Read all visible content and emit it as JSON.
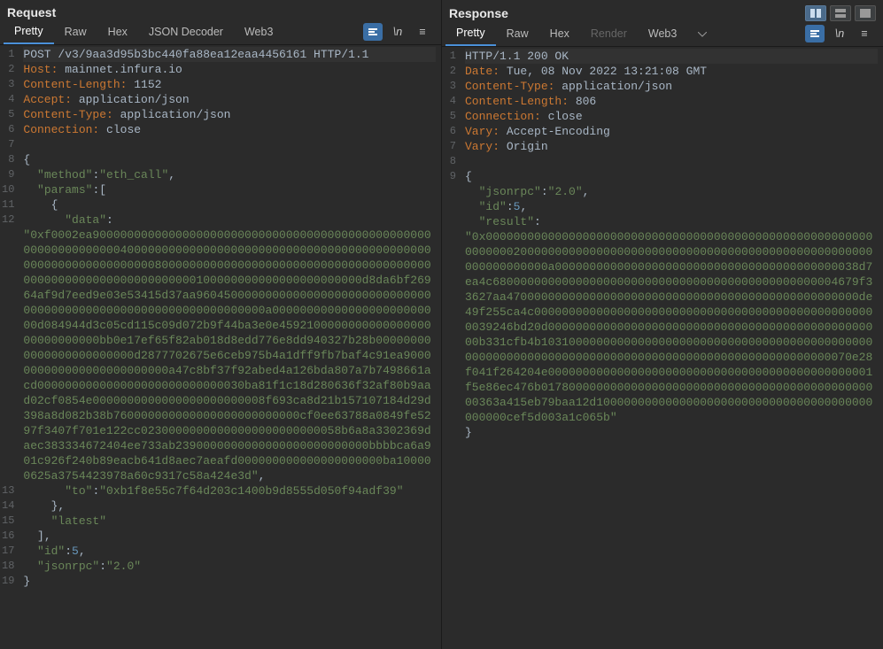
{
  "request": {
    "title": "Request",
    "tabs": [
      "Pretty",
      "Raw",
      "Hex",
      "JSON Decoder",
      "Web3"
    ],
    "activeTab": 0,
    "lines": [
      {
        "n": 1,
        "sel": true,
        "seg": [
          {
            "t": "POST /v3/9aa3d95b3bc440fa88ea12eaa4456161 HTTP/1.1",
            "c": ""
          }
        ]
      },
      {
        "n": 2,
        "seg": [
          {
            "t": "Host:",
            "c": "k-hdr"
          },
          {
            "t": " mainnet.infura.io",
            "c": ""
          }
        ]
      },
      {
        "n": 3,
        "seg": [
          {
            "t": "Content-Length:",
            "c": "k-hdr"
          },
          {
            "t": " 1152",
            "c": ""
          }
        ]
      },
      {
        "n": 4,
        "seg": [
          {
            "t": "Accept:",
            "c": "k-hdr"
          },
          {
            "t": " application/json",
            "c": ""
          }
        ]
      },
      {
        "n": 5,
        "seg": [
          {
            "t": "Content-Type:",
            "c": "k-hdr"
          },
          {
            "t": " application/json",
            "c": ""
          }
        ]
      },
      {
        "n": 6,
        "seg": [
          {
            "t": "Connection:",
            "c": "k-hdr"
          },
          {
            "t": " close",
            "c": ""
          }
        ]
      },
      {
        "n": 7,
        "seg": [
          {
            "t": "",
            "c": ""
          }
        ]
      },
      {
        "n": 8,
        "seg": [
          {
            "t": "{",
            "c": "k-pun"
          }
        ]
      },
      {
        "n": 9,
        "seg": [
          {
            "t": "  ",
            "c": ""
          },
          {
            "t": "\"method\"",
            "c": "k-str"
          },
          {
            "t": ":",
            "c": "k-pun"
          },
          {
            "t": "\"eth_call\"",
            "c": "k-str"
          },
          {
            "t": ",",
            "c": "k-pun"
          }
        ]
      },
      {
        "n": 10,
        "seg": [
          {
            "t": "  ",
            "c": ""
          },
          {
            "t": "\"params\"",
            "c": "k-str"
          },
          {
            "t": ":[",
            "c": "k-pun"
          }
        ]
      },
      {
        "n": 11,
        "seg": [
          {
            "t": "    {",
            "c": "k-pun"
          }
        ]
      },
      {
        "n": 12,
        "seg": [
          {
            "t": "      ",
            "c": ""
          },
          {
            "t": "\"data\"",
            "c": "k-str"
          },
          {
            "t": ":",
            "c": "k-pun"
          },
          {
            "t": "\n",
            "c": ""
          },
          {
            "t": "\"0xf0002ea900000000000000000000000000000000000000000000000000000000000000400000000000000000000000000000000000000000000000000000000000000080000000000000000000000000000000000000000000000000000000000000000100000000000000000000000d8da6bf26964af9d7eed9e03e53415d37aa960450000000000000000000000000000000000000000000000000000000000000000a0000000000000000000000000d084944d3c05cd115c09d072b9f44ba3e0e459210000000000000000000000000000bb0e17ef65f82ab018d8edd776e8dd940327b28b000000000000000000000000d2877702675e6ceb975b4a1dff9fb7baf4c91ea9000000000000000000000000a47c8bf37f92abed4a126bda807a7b7498661acd000000000000000000000000000030ba81f1c18d280636f32af80b9aad02cf0854e0000000000000000000000008f693ca8d21b157107184d29d398a8d082b38b760000000000000000000000000cf0ee63788a0849fe5297f3407f701e122cc02300000000000000000000000058b6a8a3302369daec383334672404ee733ab2390000000000000000000000000bbbbca6a901c926f240b89eacb641d8aec7aeafd000000000000000000000ba100000625a3754423978a60c9317c58a424e3d\"",
            "c": "k-str"
          },
          {
            "t": ",",
            "c": "k-pun"
          }
        ]
      },
      {
        "n": 13,
        "seg": [
          {
            "t": "      ",
            "c": ""
          },
          {
            "t": "\"to\"",
            "c": "k-str"
          },
          {
            "t": ":",
            "c": "k-pun"
          },
          {
            "t": "\"0xb1f8e55c7f64d203c1400b9d8555d050f94adf39\"",
            "c": "k-str"
          }
        ]
      },
      {
        "n": 14,
        "seg": [
          {
            "t": "    },",
            "c": "k-pun"
          }
        ]
      },
      {
        "n": 15,
        "seg": [
          {
            "t": "    ",
            "c": ""
          },
          {
            "t": "\"latest\"",
            "c": "k-str"
          }
        ]
      },
      {
        "n": 16,
        "seg": [
          {
            "t": "  ],",
            "c": "k-pun"
          }
        ]
      },
      {
        "n": 17,
        "seg": [
          {
            "t": "  ",
            "c": ""
          },
          {
            "t": "\"id\"",
            "c": "k-str"
          },
          {
            "t": ":",
            "c": "k-pun"
          },
          {
            "t": "5",
            "c": "k-num"
          },
          {
            "t": ",",
            "c": "k-pun"
          }
        ]
      },
      {
        "n": 18,
        "seg": [
          {
            "t": "  ",
            "c": ""
          },
          {
            "t": "\"jsonrpc\"",
            "c": "k-str"
          },
          {
            "t": ":",
            "c": "k-pun"
          },
          {
            "t": "\"2.0\"",
            "c": "k-str"
          }
        ]
      },
      {
        "n": 19,
        "seg": [
          {
            "t": "}",
            "c": "k-pun"
          }
        ]
      }
    ]
  },
  "response": {
    "title": "Response",
    "tabs": [
      "Pretty",
      "Raw",
      "Hex",
      "Render",
      "Web3"
    ],
    "activeTab": 0,
    "disabledTabs": [
      3
    ],
    "lines": [
      {
        "n": 1,
        "sel": true,
        "seg": [
          {
            "t": "HTTP/1.1 200 OK",
            "c": ""
          }
        ]
      },
      {
        "n": 2,
        "seg": [
          {
            "t": "Date:",
            "c": "k-hdr"
          },
          {
            "t": " Tue, 08 Nov 2022 13:21:08 GMT",
            "c": ""
          }
        ]
      },
      {
        "n": 3,
        "seg": [
          {
            "t": "Content-Type:",
            "c": "k-hdr"
          },
          {
            "t": " application/json",
            "c": ""
          }
        ]
      },
      {
        "n": 4,
        "seg": [
          {
            "t": "Content-Length:",
            "c": "k-hdr"
          },
          {
            "t": " 806",
            "c": ""
          }
        ]
      },
      {
        "n": 5,
        "seg": [
          {
            "t": "Connection:",
            "c": "k-hdr"
          },
          {
            "t": " close",
            "c": ""
          }
        ]
      },
      {
        "n": 6,
        "seg": [
          {
            "t": "Vary:",
            "c": "k-hdr"
          },
          {
            "t": " Accept-Encoding",
            "c": ""
          }
        ]
      },
      {
        "n": 7,
        "seg": [
          {
            "t": "Vary:",
            "c": "k-hdr"
          },
          {
            "t": " Origin",
            "c": ""
          }
        ]
      },
      {
        "n": 8,
        "seg": [
          {
            "t": "",
            "c": ""
          }
        ]
      },
      {
        "n": 9,
        "seg": [
          {
            "t": "{",
            "c": "k-pun"
          },
          {
            "t": "\n",
            "c": ""
          },
          {
            "t": "  ",
            "c": ""
          },
          {
            "t": "\"jsonrpc\"",
            "c": "k-str"
          },
          {
            "t": ":",
            "c": "k-pun"
          },
          {
            "t": "\"2.0\"",
            "c": "k-str"
          },
          {
            "t": ",",
            "c": "k-pun"
          },
          {
            "t": "\n",
            "c": ""
          },
          {
            "t": "  ",
            "c": ""
          },
          {
            "t": "\"id\"",
            "c": "k-str"
          },
          {
            "t": ":",
            "c": "k-pun"
          },
          {
            "t": "5",
            "c": "k-num"
          },
          {
            "t": ",",
            "c": "k-pun"
          },
          {
            "t": "\n",
            "c": ""
          },
          {
            "t": "  ",
            "c": ""
          },
          {
            "t": "\"result\"",
            "c": "k-str"
          },
          {
            "t": ":",
            "c": "k-pun"
          },
          {
            "t": "\n",
            "c": ""
          },
          {
            "t": "\"0x0000000000000000000000000000000000000000000000000000000000000002000000000000000000000000000000000000000000000000000000000000000a00000000000000000000000000000000000000000038d7ea4c68000000000000000000000000000000000000000000000004679f33627aa470000000000000000000000000000000000000000000000000de49f255ca4c00000000000000000000000000000000000000000000000000039246bd20d0000000000000000000000000000000000000000000000000b331cfb4b10310000000000000000000000000000000000000000000000000000000000000000000000000000000000000000000000000070e28f041f264204e00000000000000000000000000000000000000000000001f5e86ec476b01780000000000000000000000000000000000000000000000363a415eb79baa12d1000000000000000000000000000000000000000000000cef5d003a1c065b\"",
            "c": "k-str"
          },
          {
            "t": "\n",
            "c": ""
          },
          {
            "t": "}",
            "c": "k-pun"
          }
        ]
      }
    ]
  },
  "icons": {
    "wrap": "\\n",
    "menu": "≡"
  }
}
